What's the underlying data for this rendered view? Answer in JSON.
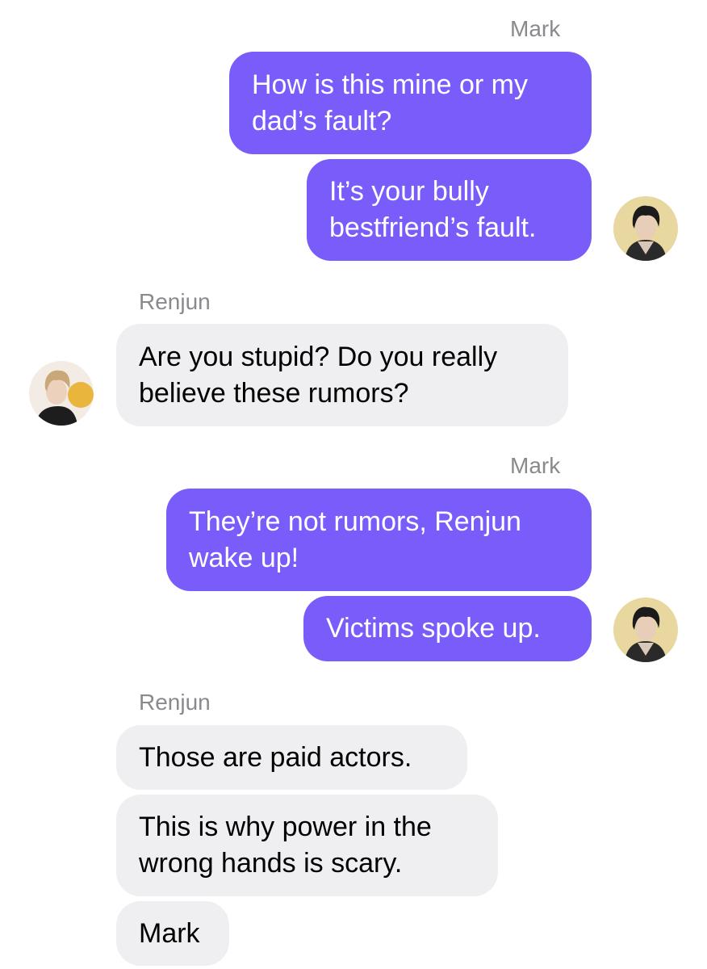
{
  "messages": [
    {
      "sender": "Mark",
      "side": "out",
      "texts": [
        "How is this mine or my\ndad’s fault?",
        "It’s your bully\nbestfriend’s fault."
      ]
    },
    {
      "sender": "Renjun",
      "side": "in",
      "texts": [
        "Are you stupid? Do you really\nbelieve these rumors?"
      ]
    },
    {
      "sender": "Mark",
      "side": "out",
      "texts": [
        "They’re not rumors, Renjun\nwake up!",
        "Victims spoke up."
      ]
    },
    {
      "sender": "Renjun",
      "side": "in",
      "texts": [
        "Those are paid actors.",
        "This is why power in the\nwrong hands is scary.",
        "Mark"
      ]
    }
  ],
  "colors": {
    "outgoing_bubble": "#7a5cfa",
    "incoming_bubble": "#efeff1",
    "sender_name": "#8a8a8e"
  },
  "icons": {
    "mark_avatar": "mark-avatar-photo",
    "renjun_avatar": "renjun-avatar-photo"
  }
}
